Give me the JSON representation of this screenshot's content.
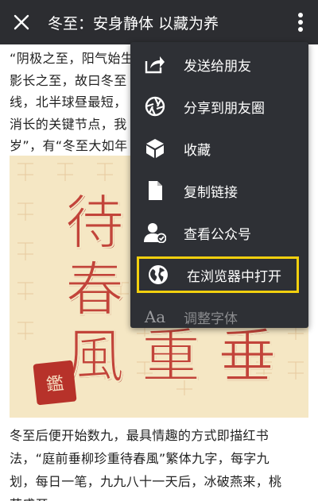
{
  "header": {
    "title": "冬至：安身静体 以藏为养"
  },
  "article": {
    "para1_lines": [
      "“阴极之至，阳气始生",
      "影长之至，故曰冬至",
      "线，北半球昼最短，",
      "消长的关键节点，我",
      "岁”，有“冬至大如年"
    ],
    "poster_chars": [
      "待",
      "春",
      "風",
      "重",
      "垂"
    ],
    "poster_seal": "鑑",
    "para2_lines": [
      "冬至后便开始数九，最具情趣的方式即描红书",
      "法，“庭前垂柳珍重待春風”繁体九字，每字九",
      "划，每日一笔，九九八十一天后，冰破燕来，桃",
      "花盛开。"
    ]
  },
  "menu": {
    "items": [
      {
        "label": "发送给朋友",
        "icon": "share-forward-icon"
      },
      {
        "label": "分享到朋友圈",
        "icon": "moments-aperture-icon"
      },
      {
        "label": "收藏",
        "icon": "favorite-cube-icon"
      },
      {
        "label": "复制链接",
        "icon": "copy-document-icon"
      },
      {
        "label": "查看公众号",
        "icon": "official-account-icon"
      },
      {
        "label": "在浏览器中打开",
        "icon": "globe-icon",
        "highlighted": true
      },
      {
        "label": "调整字体",
        "icon": "font-size-icon"
      }
    ]
  },
  "colors": {
    "header_bg": "#2c2d31",
    "menu_bg": "#2e3035",
    "highlight_border": "#f2d00e",
    "poster_bg": "#f5e7c4",
    "poster_char": "#c2443a"
  }
}
